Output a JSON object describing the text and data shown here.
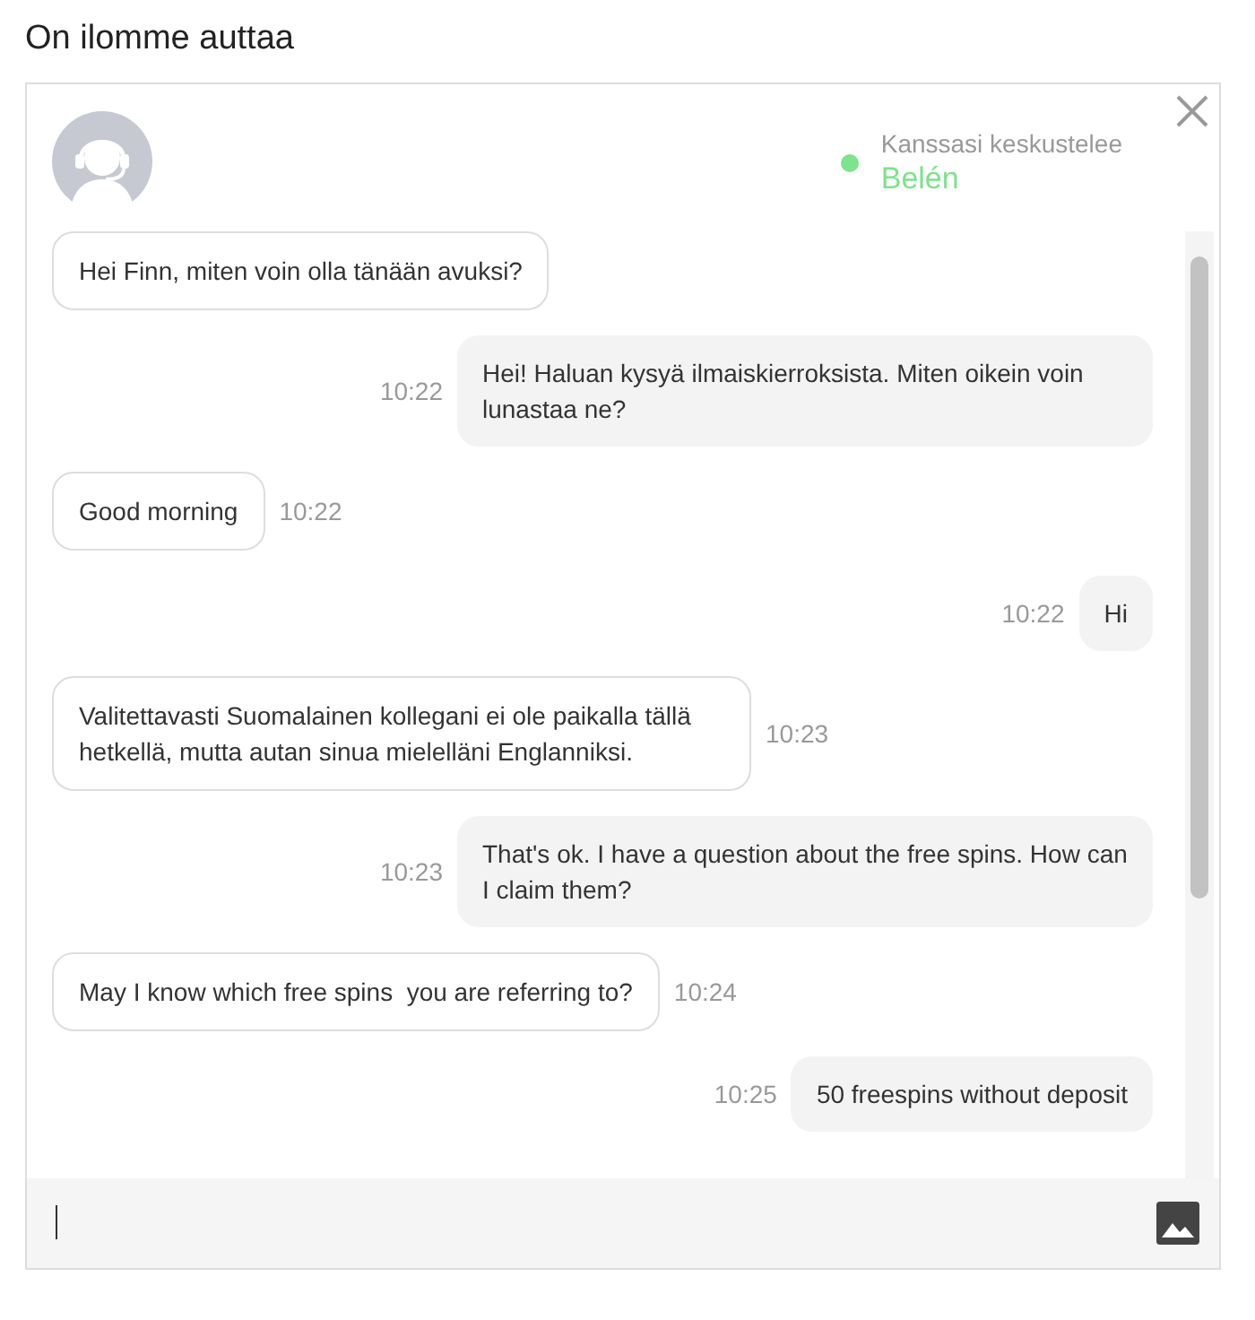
{
  "title": "On ilomme auttaa",
  "header": {
    "status_label": "Kanssasi keskustelee",
    "agent_name": "Belén",
    "online": true
  },
  "messages": [
    {
      "kind": "agent",
      "text": "Hei Finn, miten voin olla tänään avuksi?"
    },
    {
      "kind": "user",
      "text": "Hei! Haluan kysyä ilmaiskierroksista. Miten oikein voin lunastaa ne?",
      "time": "10:22"
    },
    {
      "kind": "agent",
      "text": "Good morning",
      "time": "10:22"
    },
    {
      "kind": "user",
      "text": "Hi",
      "time": "10:22"
    },
    {
      "kind": "agent",
      "text": "Valitettavasti Suomalainen kollegani ei ole paikalla tällä hetkellä, mutta autan sinua mielelläni Englanniksi.",
      "time": "10:23"
    },
    {
      "kind": "user",
      "text": "That's ok. I have a question about the free spins. How can I claim them?",
      "time": "10:23"
    },
    {
      "kind": "agent",
      "text": "May I know which free spins  you are referring to?",
      "time": "10:24"
    },
    {
      "kind": "user",
      "text": "50 freespins without deposit",
      "time": "10:25"
    }
  ]
}
